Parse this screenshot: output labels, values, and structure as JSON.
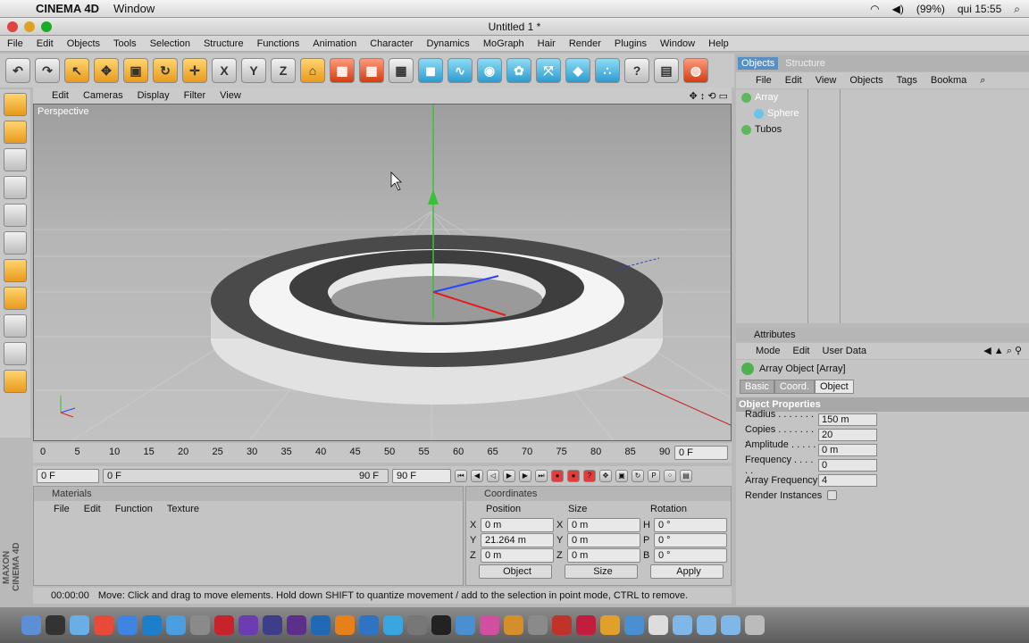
{
  "mac_menu": {
    "app": "CINEMA 4D",
    "window": "Window",
    "battery": "(99%)",
    "clock": "qui 15:55"
  },
  "window": {
    "title": "Untitled 1 *"
  },
  "menus": [
    "File",
    "Edit",
    "Objects",
    "Tools",
    "Selection",
    "Structure",
    "Functions",
    "Animation",
    "Character",
    "Dynamics",
    "MoGraph",
    "Hair",
    "Render",
    "Plugins",
    "Window",
    "Help"
  ],
  "axes_buttons": [
    "X",
    "Y",
    "Z"
  ],
  "view_menu": [
    "Edit",
    "Cameras",
    "Display",
    "Filter",
    "View"
  ],
  "viewport": {
    "label": "Perspective"
  },
  "timeline": {
    "ticks": [
      "0",
      "5",
      "10",
      "15",
      "20",
      "25",
      "30",
      "35",
      "40",
      "45",
      "50",
      "55",
      "60",
      "65",
      "70",
      "75",
      "80",
      "85",
      "90"
    ],
    "current": "0 F",
    "start": "0 F",
    "slider_left": "0 F",
    "slider_right": "90 F",
    "end": "90 F"
  },
  "materials": {
    "title": "Materials",
    "menu": [
      "File",
      "Edit",
      "Function",
      "Texture"
    ]
  },
  "coordinates": {
    "title": "Coordinates",
    "headers": [
      "Position",
      "Size",
      "Rotation"
    ],
    "rows": [
      {
        "axis": "X",
        "pos": "0 m",
        "saxis": "X",
        "size": "0 m",
        "raxis": "H",
        "rot": "0 °"
      },
      {
        "axis": "Y",
        "pos": "21.264 m",
        "saxis": "Y",
        "size": "0 m",
        "raxis": "P",
        "rot": "0 °"
      },
      {
        "axis": "Z",
        "pos": "0 m",
        "saxis": "Z",
        "size": "0 m",
        "raxis": "B",
        "rot": "0 °"
      }
    ],
    "mode_select": "Object",
    "size_select": "Size",
    "apply": "Apply"
  },
  "status": {
    "time": "00:00:00",
    "message": "Move: Click and drag to move elements. Hold down SHIFT to quantize movement / add to the selection in point mode, CTRL to remove."
  },
  "brand": "MAXON CINEMA 4D",
  "objects_panel": {
    "tabs": [
      "Objects",
      "Structure"
    ],
    "menu": [
      "File",
      "Edit",
      "View",
      "Objects",
      "Tags",
      "Bookma"
    ],
    "items": [
      {
        "name": "Array",
        "indent": 0,
        "selected": true
      },
      {
        "name": "Sphere",
        "indent": 1,
        "selected": true
      },
      {
        "name": "Tubos",
        "indent": 0,
        "selected": false
      }
    ]
  },
  "attributes": {
    "title": "Attributes",
    "menu": [
      "Mode",
      "Edit",
      "User Data"
    ],
    "object_title": "Array Object [Array]",
    "tabs": [
      "Basic",
      "Coord.",
      "Object"
    ],
    "section": "Object Properties",
    "props": [
      {
        "label": "Radius . . . . . . . .",
        "value": "150 m"
      },
      {
        "label": "Copies . . . . . . . .",
        "value": "20"
      },
      {
        "label": "Amplitude . . . . . .",
        "value": "0 m"
      },
      {
        "label": "Frequency . . . . . .",
        "value": "0"
      },
      {
        "label": "Array Frequency",
        "value": "4"
      }
    ],
    "render_instances": "Render Instances"
  }
}
